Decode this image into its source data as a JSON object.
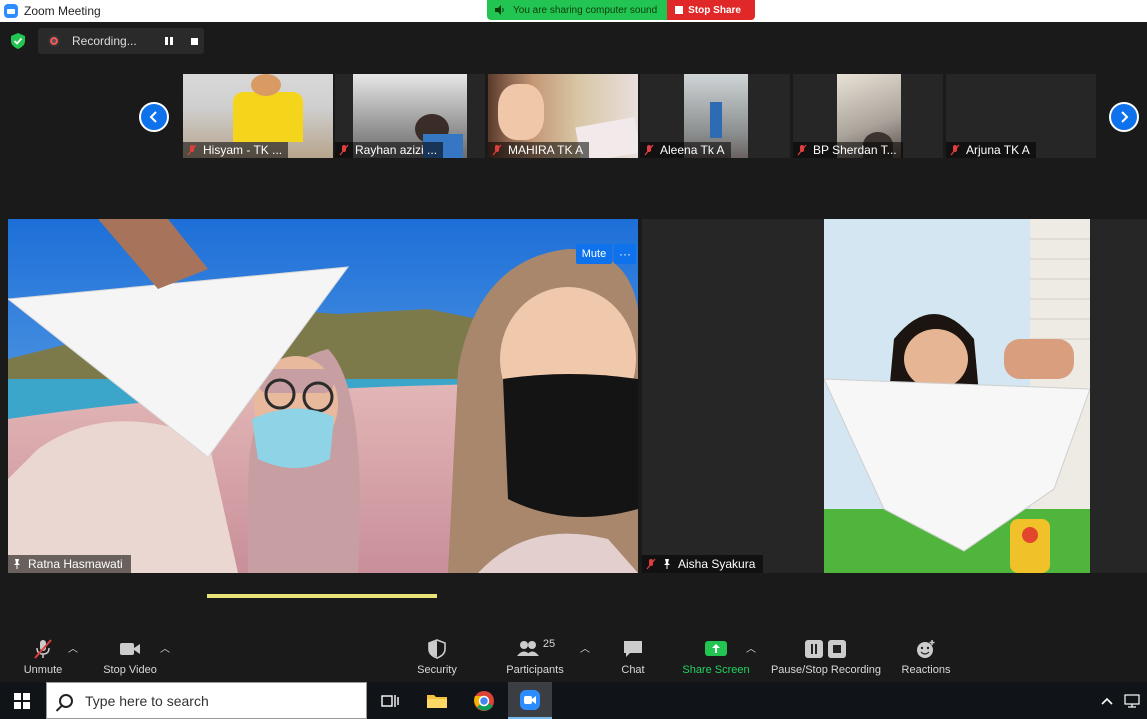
{
  "window": {
    "title": "Zoom Meeting"
  },
  "share_banner": {
    "sound_text": "You are sharing computer sound",
    "stop_share_label": "Stop Share"
  },
  "recording": {
    "label": "Recording..."
  },
  "strip": {
    "participants": [
      {
        "name": "Hisyam - TK ..."
      },
      {
        "name": "Rayhan azizi ..."
      },
      {
        "name": "MAHIRA TK A"
      },
      {
        "name": "Aleena Tk A"
      },
      {
        "name": "BP Sherdan T..."
      },
      {
        "name": "Arjuna TK A"
      }
    ]
  },
  "main": {
    "speaker_name": "Ratna Hasmawati",
    "mute_label": "Mute",
    "more_label": "···",
    "second_name": "Aisha Syakura"
  },
  "toolbar": {
    "unmute": "Unmute",
    "stop_video": "Stop Video",
    "security": "Security",
    "participants": "Participants",
    "participant_count": "25",
    "chat": "Chat",
    "share_screen": "Share Screen",
    "recording": "Pause/Stop Recording",
    "reactions": "Reactions"
  },
  "taskbar": {
    "search_placeholder": "Type here to search"
  },
  "colors": {
    "zoom_blue": "#0e72ed",
    "share_green": "#23c552",
    "stop_red": "#e02828",
    "bg": "#1a1a1a"
  }
}
